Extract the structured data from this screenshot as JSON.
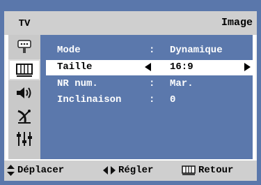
{
  "header": {
    "tv_tab": "TV",
    "title": "Image"
  },
  "sidebar": {
    "icons": [
      "input-icon",
      "picture-icon",
      "sound-icon",
      "channel-icon",
      "setup-icon"
    ],
    "active": "picture-icon"
  },
  "menu": {
    "rows": [
      {
        "label": "Mode",
        "sep": ":",
        "value": "Dynamique"
      },
      {
        "label": "Taille",
        "sep": "",
        "value": "16:9",
        "selected": true
      },
      {
        "label": "NR num.",
        "sep": ":",
        "value": "Mar."
      },
      {
        "label": "Inclinaison",
        "sep": ":",
        "value": "0"
      }
    ]
  },
  "footer": {
    "move_label": "Déplacer",
    "adjust_label": "Régler",
    "return_label": "Retour",
    "move_icon": "up-down-arrows-icon",
    "adjust_icon": "left-right-arrows-icon",
    "return_icon": "menu-icon"
  },
  "colors": {
    "background": "#5a77ab",
    "panel": "#5b78ac",
    "bars": "#cfcfcf",
    "selected_row": "#ffffff"
  }
}
